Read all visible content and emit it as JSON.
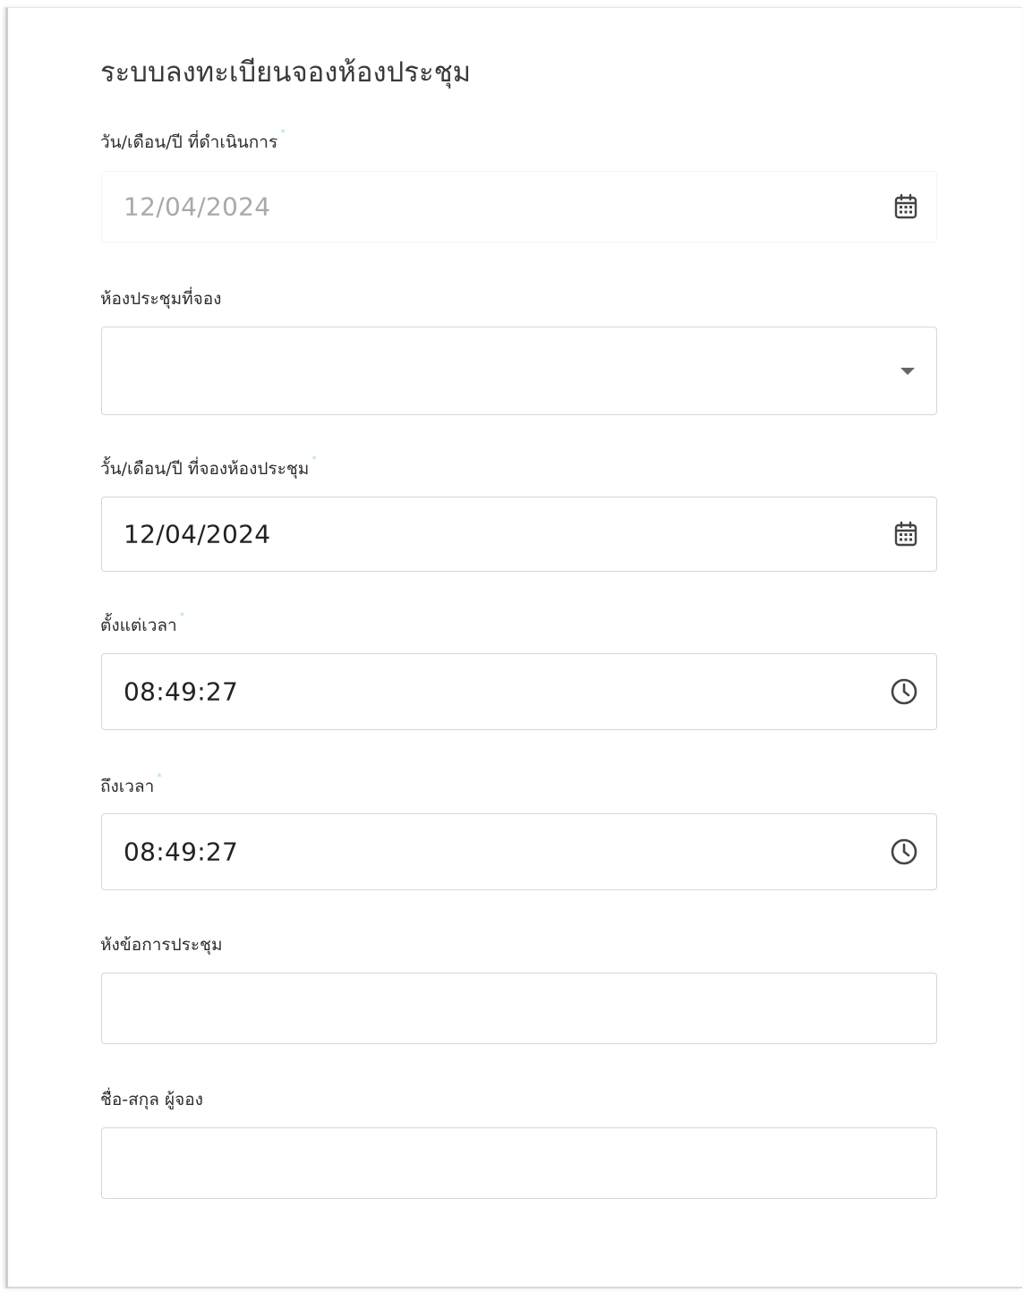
{
  "form": {
    "title": "ระบบลงทะเบียนจองห้องประชุม",
    "required_mark": "*",
    "fields": {
      "operation_date": {
        "label": "วัน/เดือน/ปี ที่ดำเนินการ",
        "value": "12/04/2024",
        "icon": "calendar-icon",
        "disabled": true
      },
      "room": {
        "label": "ห้องประชุมที่จอง",
        "value": "",
        "icon": "dropdown-arrow-icon"
      },
      "booking_date": {
        "label": "วั้น/เดือน/ปี ที่จองห้องประชุม",
        "value": "12/04/2024",
        "icon": "calendar-icon"
      },
      "start_time": {
        "label": "ตั้งแต่เวลา",
        "value": "08:49:27",
        "icon": "clock-icon"
      },
      "end_time": {
        "label": "ถึงเวลา",
        "value": "08:49:27",
        "icon": "clock-icon"
      },
      "topic": {
        "label": "หังข้อการประชุม",
        "value": ""
      },
      "booker_name": {
        "label": "ชื่อ-สกุล ผู้จอง",
        "value": ""
      }
    }
  },
  "colors": {
    "required_mark": "#9fd9f1",
    "border": "#d6d6d6",
    "text": "#222222",
    "disabled_text": "#a9a9a9"
  }
}
